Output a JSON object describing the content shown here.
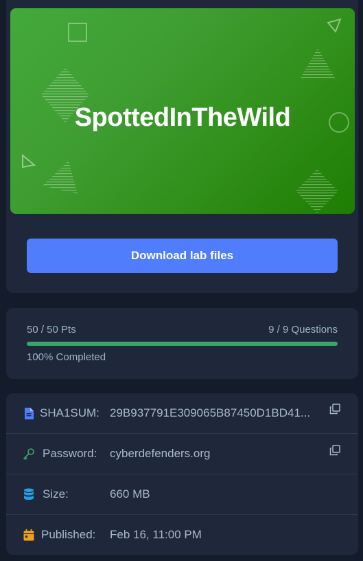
{
  "banner": {
    "title": "SpottedInTheWild"
  },
  "download": {
    "label": "Download lab files"
  },
  "progress": {
    "points": "50 / 50 Pts",
    "questions": "9 / 9 Questions",
    "completed": "100% Completed",
    "fraction": 1.0,
    "bar_color": "#3aa56b"
  },
  "info": {
    "sha1": {
      "label": "SHA1SUM:",
      "value": "29B937791E309065B87450D1BD41...",
      "icon": "document-icon",
      "icon_color": "#4f7dfb"
    },
    "password": {
      "label": "Password:",
      "value": "cyberdefenders.org",
      "icon": "key-icon",
      "icon_color": "#3aa56b"
    },
    "size": {
      "label": "Size:",
      "value": "660 MB",
      "icon": "database-icon",
      "icon_color": "#1fa2e6"
    },
    "published": {
      "label": "Published:",
      "value": "Feb 16, 11:00 PM",
      "icon": "calendar-icon",
      "icon_color": "#f0a01a"
    }
  },
  "colors": {
    "accent": "#4f7dfb",
    "banner_green": "#2f8d18"
  }
}
